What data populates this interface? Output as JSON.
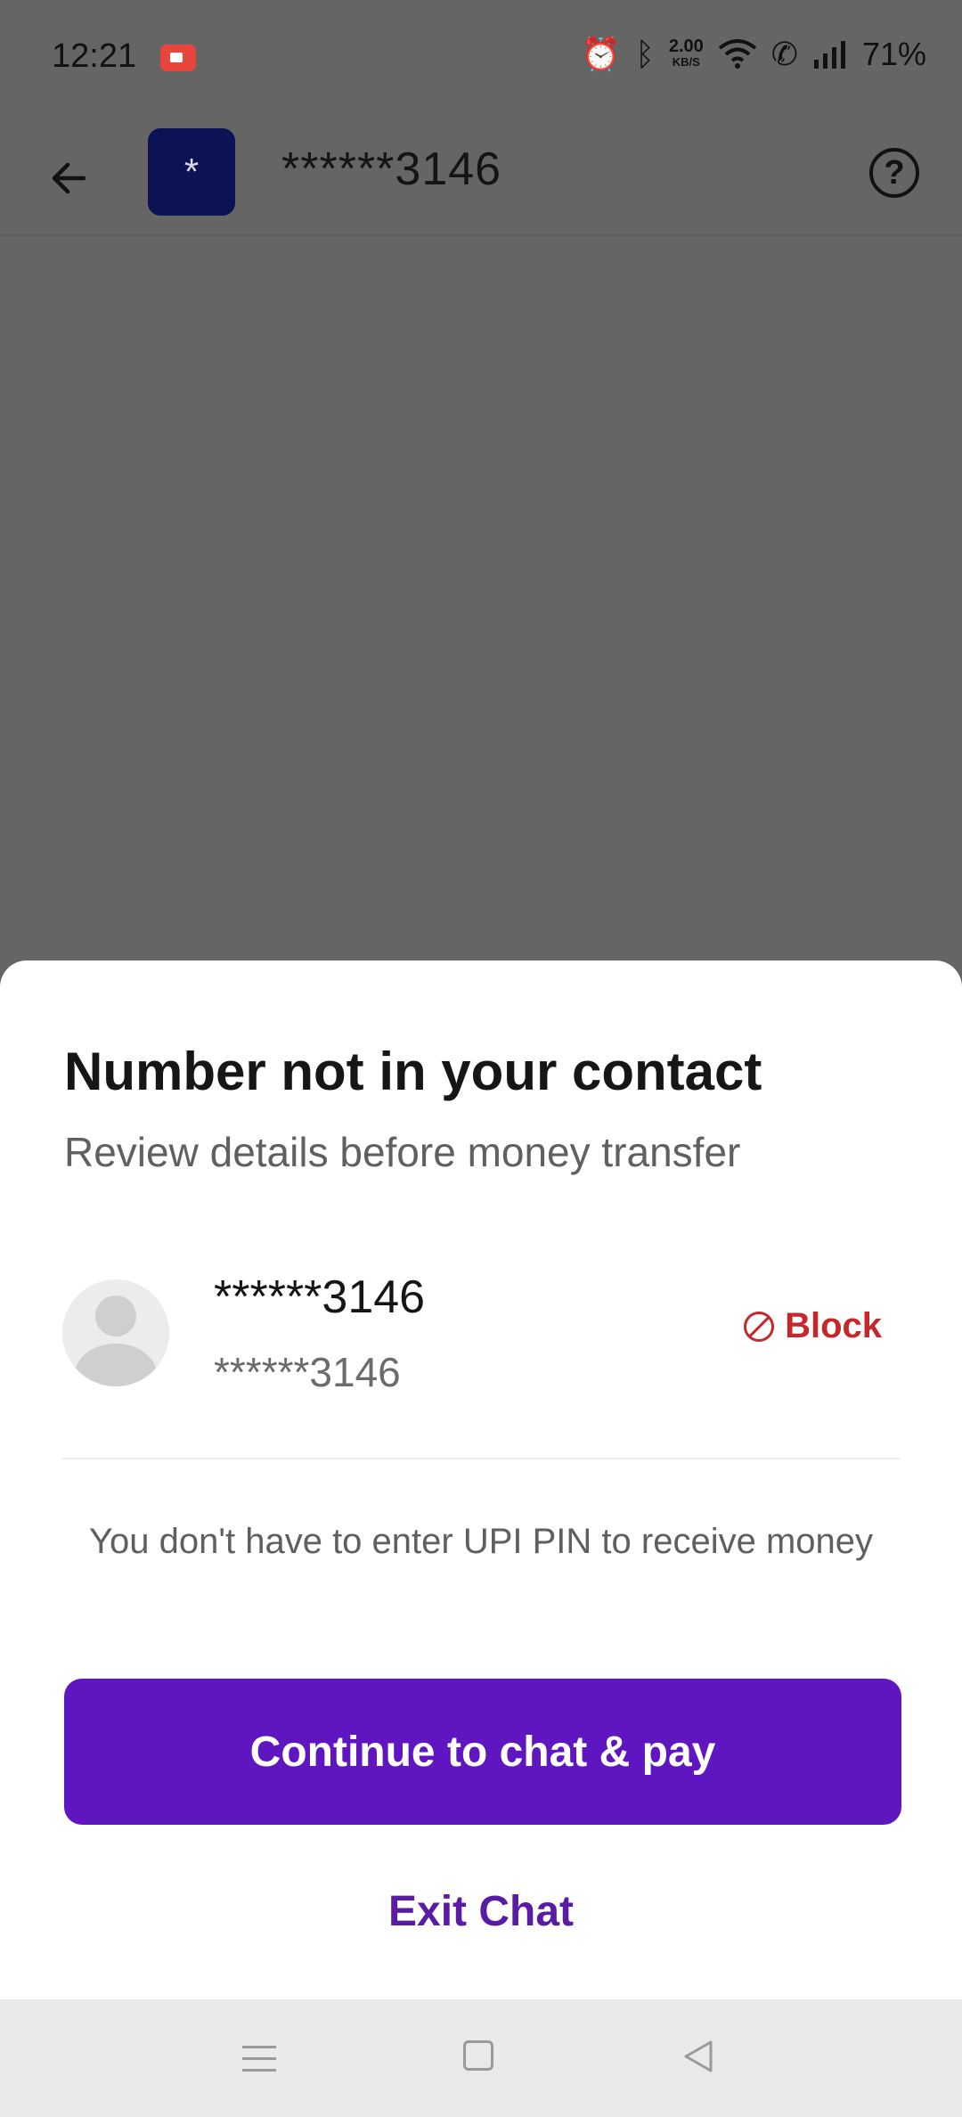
{
  "status_bar": {
    "time": "12:21",
    "net_speed": "2.00",
    "net_unit": "KB/S",
    "battery": "71%"
  },
  "header": {
    "avatar_glyph": "*",
    "title": "******3146",
    "help_glyph": "?"
  },
  "sheet": {
    "title": "Number not in your contact",
    "subtitle": "Review details before money transfer",
    "contact": {
      "name": "******3146",
      "number": "******3146"
    },
    "block_label": "Block",
    "info_text": "You don't have to enter UPI PIN to receive money",
    "primary_button": "Continue to chat & pay",
    "secondary_button": "Exit Chat"
  },
  "colors": {
    "overlay": "#656565",
    "primary": "#5f16c0",
    "block": "#c4282c",
    "exit": "#5a1ba4"
  }
}
